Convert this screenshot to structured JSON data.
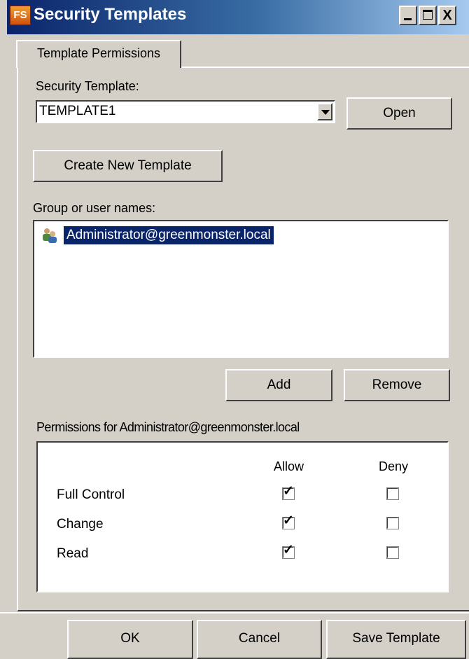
{
  "window": {
    "title": "Security Templates",
    "app_icon_text": "FS",
    "controls": {
      "minimize": "_",
      "maximize": "□",
      "close": "X"
    }
  },
  "tab": {
    "label": "Template Permissions"
  },
  "security_template": {
    "label": "Security Template:",
    "value": "TEMPLATE1",
    "open_label": "Open"
  },
  "create_button_label": "Create New Template",
  "users": {
    "label": "Group or user names:",
    "items": [
      {
        "name": "Administrator@greenmonster.local",
        "selected": true
      }
    ],
    "add_label": "Add",
    "remove_label": "Remove"
  },
  "permissions": {
    "label": "Permissions for Administrator@greenmonster.local",
    "allow_header": "Allow",
    "deny_header": "Deny",
    "rows": [
      {
        "name": "Full Control",
        "allow": true,
        "deny": false
      },
      {
        "name": "Change",
        "allow": true,
        "deny": false
      },
      {
        "name": "Read",
        "allow": true,
        "deny": false
      }
    ]
  },
  "footer": {
    "ok_label": "OK",
    "cancel_label": "Cancel",
    "save_label": "Save Template"
  },
  "colors": {
    "titlebar_start": "#0a246a",
    "selection": "#0a246a",
    "face": "#d4d0c8"
  }
}
